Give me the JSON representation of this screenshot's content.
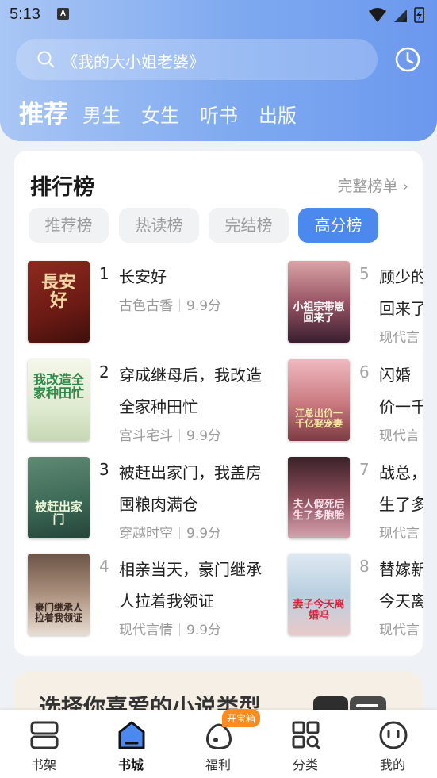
{
  "status_bar": {
    "time": "5:13",
    "notification_letter": "A"
  },
  "search": {
    "placeholder": "《我的大小姐老婆》"
  },
  "tabs": [
    {
      "label": "推荐",
      "active": true
    },
    {
      "label": "男生"
    },
    {
      "label": "女生"
    },
    {
      "label": "听书"
    },
    {
      "label": "出版"
    }
  ],
  "ranking": {
    "title": "排行榜",
    "more": "完整榜单 ›",
    "chips": [
      {
        "label": "推荐榜"
      },
      {
        "label": "热读榜"
      },
      {
        "label": "完结榜"
      },
      {
        "label": "高分榜",
        "active": true
      }
    ],
    "books": [
      {
        "rank": "1",
        "title": "长安好",
        "genre": "古色古香",
        "score": "9.9分",
        "cover_text": "長安好"
      },
      {
        "rank": "2",
        "title": "穿成继母后，我改造全家种田忙",
        "genre": "宫斗宅斗",
        "score": "9.9分",
        "cover_text": "我改造全家种田忙"
      },
      {
        "rank": "3",
        "title": "被赶出家门，我盖房囤粮肉满仓",
        "genre": "穿越时空",
        "score": "9.9分",
        "cover_text": "被赶出家门"
      },
      {
        "rank": "4",
        "title": "相亲当天，豪门继承人拉着我领证",
        "genre": "现代言情",
        "score": "9.9分",
        "cover_text": "豪门继承人拉着我领证"
      },
      {
        "rank": "5",
        "title": "顾少的",
        "title2": "回来了",
        "genre": "现代言",
        "cover_text": "小祖宗带崽回来了"
      },
      {
        "rank": "6",
        "title": "闪婚",
        "title2": "价一千",
        "genre": "现代言",
        "cover_text": "江总出价一千亿娶宠妻"
      },
      {
        "rank": "7",
        "title": "战总，",
        "title2": "生了多",
        "genre": "现代言",
        "cover_text": "夫人假死后生了多胞胎"
      },
      {
        "rank": "8",
        "title": "替嫁新",
        "title2": "今天离",
        "genre": "现代言",
        "cover_text": "妻子今天离婚吗"
      }
    ]
  },
  "promo": {
    "text": "选择你喜爱的小说类型"
  },
  "tabbar": [
    {
      "label": "书架",
      "icon": "bookshelf-icon"
    },
    {
      "label": "书城",
      "icon": "bookstore-icon",
      "active": true
    },
    {
      "label": "福利",
      "icon": "welfare-bag-icon",
      "badge": "开宝箱"
    },
    {
      "label": "分类",
      "icon": "category-grid-icon"
    },
    {
      "label": "我的",
      "icon": "profile-face-icon"
    }
  ],
  "colors": {
    "accent": "#4b89ef",
    "badge": "#ff8a1f",
    "header_start": "#a9c6f5",
    "header_end": "#6b98ee"
  }
}
